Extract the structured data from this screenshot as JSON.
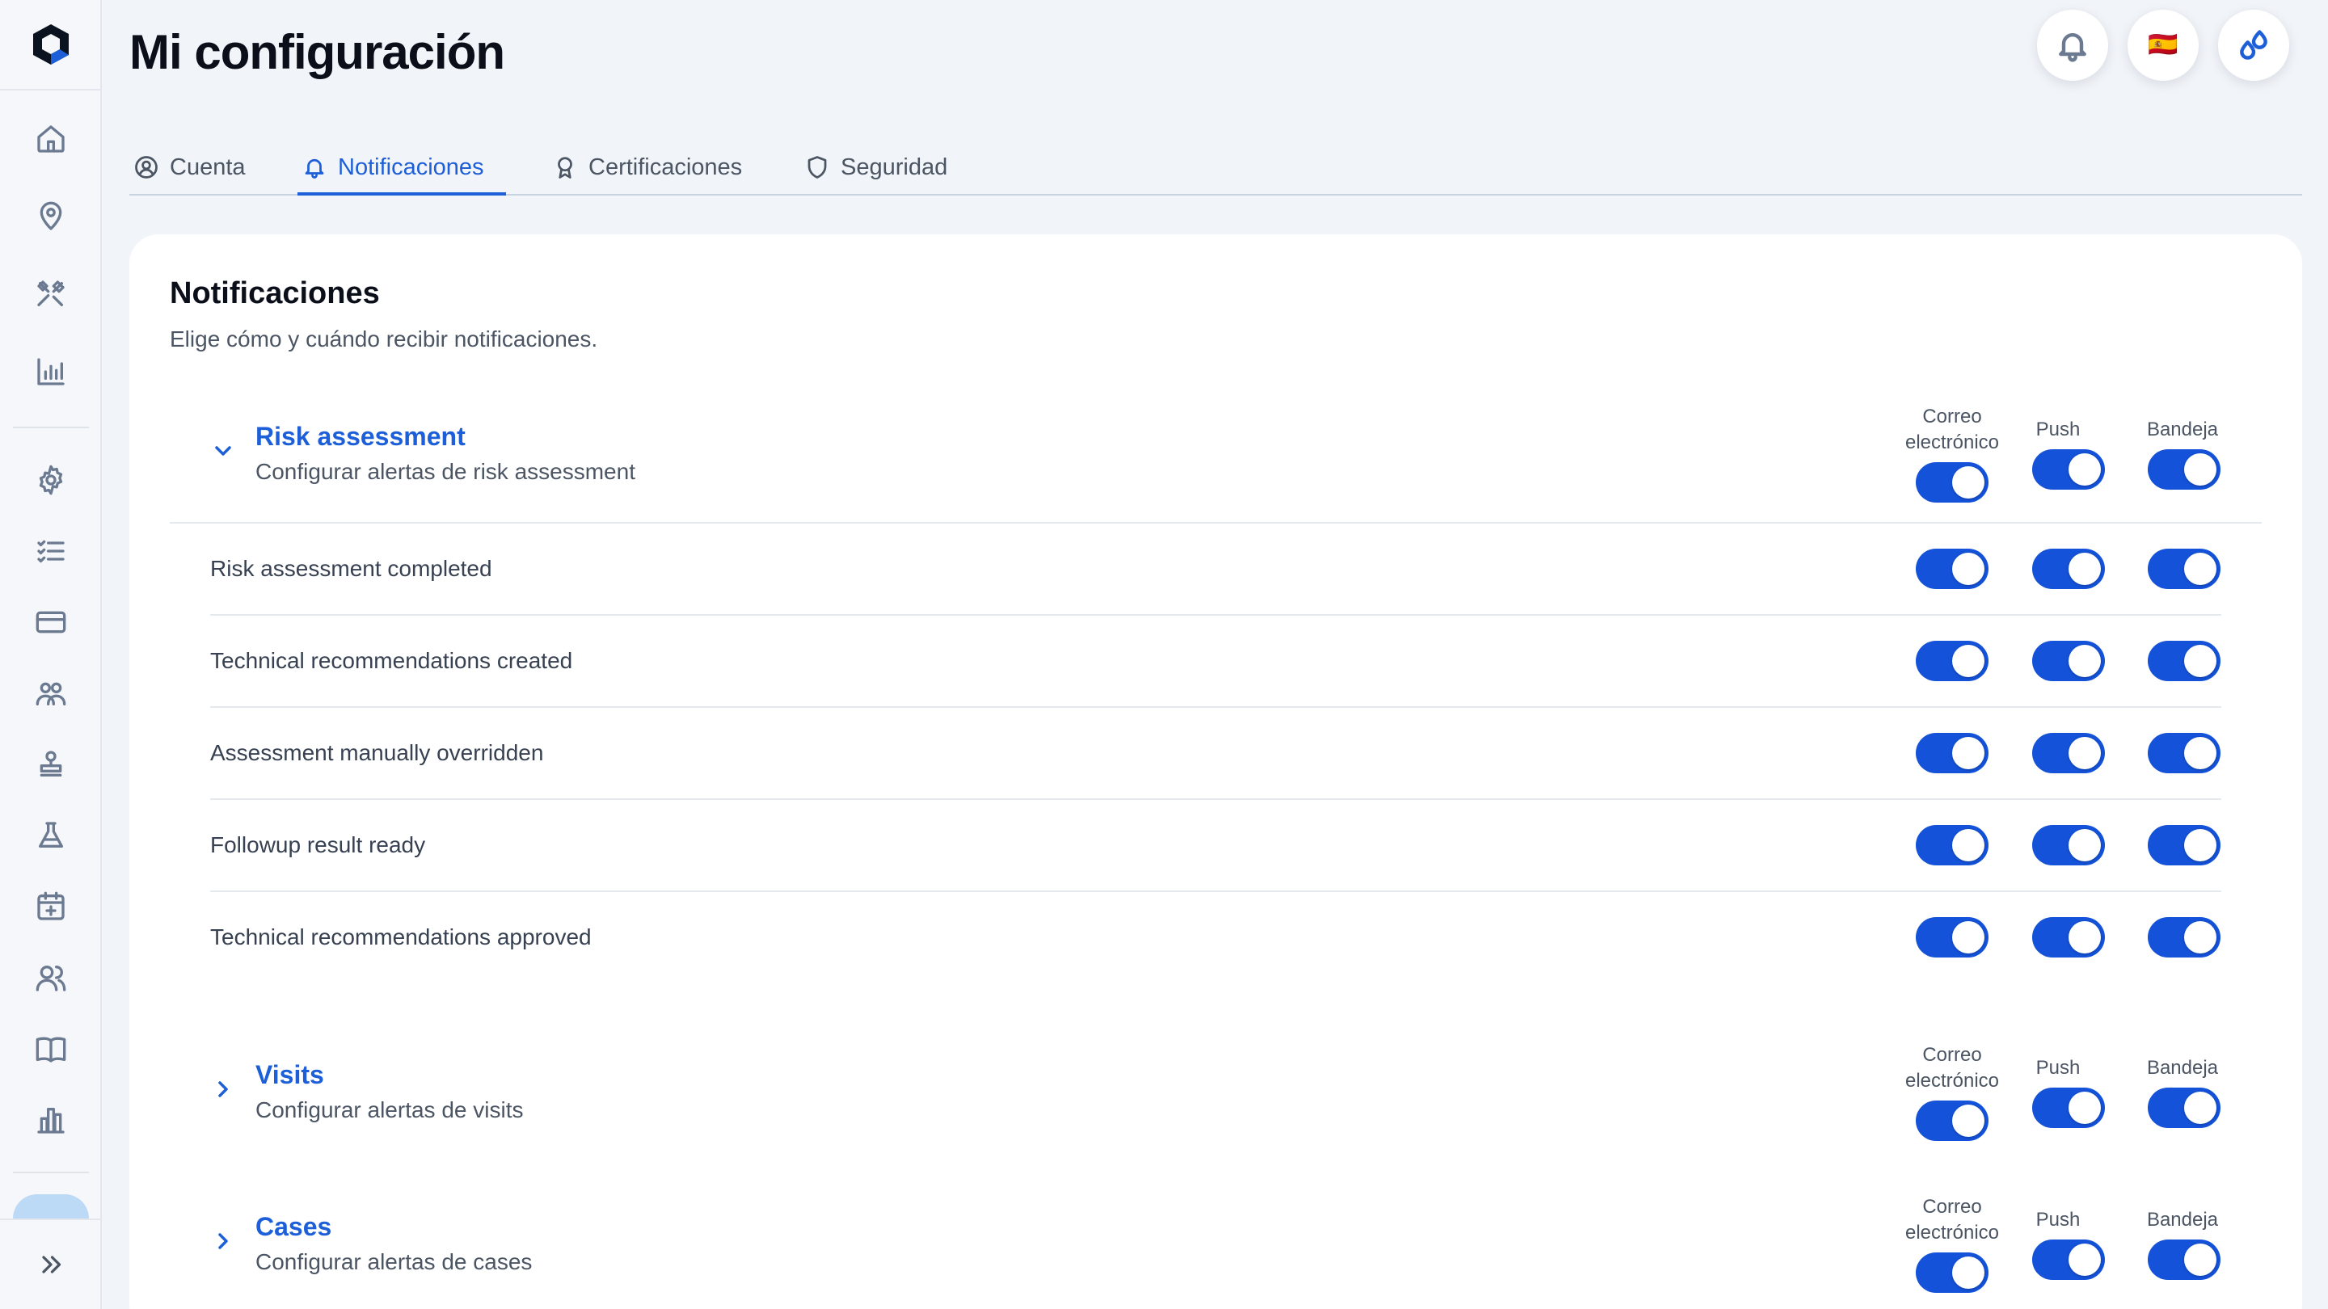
{
  "page": {
    "title": "Mi configuración"
  },
  "topbar": {
    "language_flag": "🇪🇸"
  },
  "sidebar": {
    "icons": [
      "home-icon",
      "location-pin-icon",
      "tools-icon",
      "bar-chart-icon",
      "settings-gear-icon",
      "checklist-icon",
      "credit-card-icon",
      "groups-icon",
      "stamp-icon",
      "lab-flask-icon",
      "calendar-add-icon",
      "users-icon",
      "book-icon",
      "building-chart-icon"
    ],
    "expand_icon": "double-chevron-right-icon"
  },
  "tabs": [
    {
      "label": "Cuenta",
      "icon": "user-circle-icon",
      "active": false
    },
    {
      "label": "Notificaciones",
      "icon": "bell-icon",
      "active": true
    },
    {
      "label": "Certificaciones",
      "icon": "award-icon",
      "active": false
    },
    {
      "label": "Seguridad",
      "icon": "shield-icon",
      "active": false
    }
  ],
  "card": {
    "title": "Notificaciones",
    "subtitle": "Elige cómo y cuándo recibir notificaciones."
  },
  "columns": {
    "email_line1": "Correo",
    "email_line2": "electrónico",
    "push": "Push",
    "inbox": "Bandeja"
  },
  "sections": [
    {
      "title": "Risk assessment",
      "description": "Configurar alertas de risk assessment",
      "expanded": true,
      "toggles": {
        "email": true,
        "push": true,
        "inbox": true
      },
      "rows": [
        {
          "label": "Risk assessment completed",
          "email": true,
          "push": true,
          "inbox": true
        },
        {
          "label": "Technical recommendations created",
          "email": true,
          "push": true,
          "inbox": true
        },
        {
          "label": "Assessment manually overridden",
          "email": true,
          "push": true,
          "inbox": true
        },
        {
          "label": "Followup result ready",
          "email": true,
          "push": true,
          "inbox": true
        },
        {
          "label": "Technical recommendations approved",
          "email": true,
          "push": true,
          "inbox": true
        }
      ]
    },
    {
      "title": "Visits",
      "description": "Configurar alertas de visits",
      "expanded": false,
      "toggles": {
        "email": true,
        "push": true,
        "inbox": true
      }
    },
    {
      "title": "Cases",
      "description": "Configurar alertas de cases",
      "expanded": false,
      "toggles": {
        "email": true,
        "push": true,
        "inbox": true
      }
    }
  ],
  "colors": {
    "accent": "#1d5fd8",
    "toggle_on": "#1452d9",
    "background": "#f1f4f8"
  }
}
